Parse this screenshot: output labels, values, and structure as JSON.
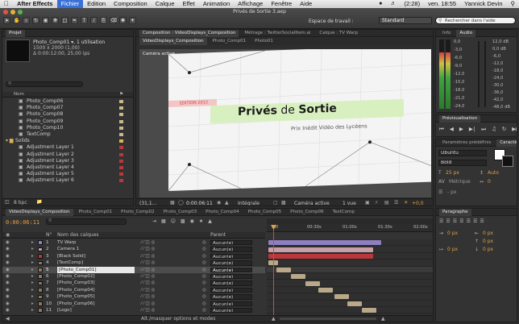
{
  "menubar": {
    "apple": "",
    "app": "After Effects",
    "items": [
      "Fichier",
      "Edition",
      "Composition",
      "Calque",
      "Effet",
      "Animation",
      "Affichage",
      "Fenêtre",
      "Aide"
    ],
    "battery": "(2:28)",
    "clock": "ven. 18:55",
    "user": "Yannick Devin"
  },
  "window": {
    "title": "Privés de Sortie 3.aep",
    "workspace_label": "Espace de travail :",
    "workspace_value": "Standard",
    "help_placeholder": "Rechercher dans l'aide"
  },
  "project": {
    "tab": "Projet",
    "item_name": "Photo_Comp01 ▾, 1 utilisation",
    "item_size": "1500 x 2000 (1,00)",
    "item_duration": "Δ 0:00:12:00, 25,00 ips",
    "search_placeholder": "",
    "column_name": "Nom",
    "items": [
      {
        "name": "Photo_Comp06",
        "indent": true
      },
      {
        "name": "Photo_Comp07",
        "indent": true
      },
      {
        "name": "Photo_Comp08",
        "indent": true
      },
      {
        "name": "Photo_Comp09",
        "indent": true
      },
      {
        "name": "Photo_Comp10",
        "indent": true
      },
      {
        "name": "TextComp",
        "indent": true
      },
      {
        "name": "Solids",
        "indent": false,
        "folder": true
      },
      {
        "name": "Adjustment Layer 1",
        "indent": true
      },
      {
        "name": "Adjustment Layer 2",
        "indent": true
      },
      {
        "name": "Adjustment Layer 3",
        "indent": true
      },
      {
        "name": "Adjustment Layer 4",
        "indent": true
      },
      {
        "name": "Adjustment Layer 5",
        "indent": true
      },
      {
        "name": "Adjustment Layer 6",
        "indent": true
      }
    ],
    "bpc": "8 bpc"
  },
  "composition": {
    "tab_prefix": "Composition :",
    "tab_name": "VideoDisplays_Composition",
    "tab_metrage": "Métrage : TwitterSocialItem.ai",
    "tab_calque": "Calque : TV Warp",
    "subtabs": [
      "VideoDisplays_Composition",
      "Photo_Comp01",
      "Photo01"
    ],
    "camera_label": "Caméra active",
    "edition_label": "EDITION 2012",
    "title_part1": "Privés",
    "title_part2": " de ",
    "title_part3": "Sortie",
    "subtitle": "Prix Inédit Vidéo des Lycéens",
    "zoom": "(31,1...",
    "timecode": "0:00:06:11",
    "resolution": "Intégrale",
    "view_camera": "Caméra active",
    "views": "1 vue",
    "offset": "+0,0"
  },
  "info_audio": {
    "tabs": [
      "Info",
      "Audio"
    ],
    "left_labels": [
      "0,0",
      "-3,0",
      "-6,0",
      "-9,0",
      "-12,0",
      "-15,0",
      "-18,0",
      "-21,0",
      "-24,0"
    ],
    "right_labels": [
      "12,0 dB",
      "0,0 dB",
      "-6,0",
      "-12,0",
      "-18,0",
      "-24,0",
      "-30,0",
      "-36,0",
      "-42,0",
      "-48,0 dB"
    ]
  },
  "preview": {
    "tab": "Prévisualisation"
  },
  "character": {
    "tabs": [
      "Paramètres prédéfinis",
      "Caractère"
    ],
    "font": "Ubuntu",
    "style": "Bold",
    "size": "25 px",
    "leading": "Auto",
    "tracking": "Métrique",
    "kerning": "0",
    "stroke": "- px"
  },
  "paragraph": {
    "tab": "Paragraphe",
    "fields": [
      "0 px",
      "0 px",
      "0 px",
      "0 px",
      "0 px"
    ]
  },
  "timeline": {
    "tabs": [
      "VideoDisplays_Composition",
      "Photo_Comp01",
      "Photo_Comp02",
      "Photo_Comp03",
      "Photo_Comp04",
      "Photo_Comp05",
      "Photo_Comp06",
      "TextComp"
    ],
    "timecode": "0:00:06:11",
    "col_num": "N°",
    "col_name": "Nom des calques",
    "col_parent": "Parent",
    "ruler": [
      "00f",
      "00:30s",
      "01:00s",
      "01:30s",
      "02:00s"
    ],
    "footer": "Alt./masquer options et modes",
    "layers": [
      {
        "num": "1",
        "name": "TV Warp",
        "color": "#8e7fc0",
        "parent": "Aucun(e)",
        "selected": false
      },
      {
        "num": "2",
        "name": "Camera 1",
        "color": "#c7a0a7",
        "parent": "Aucun(e)",
        "selected": false
      },
      {
        "num": "3",
        "name": "[Black Solid]",
        "color": "#b8383c",
        "parent": "Aucun(e)",
        "selected": false
      },
      {
        "num": "4",
        "name": "[TextComp]",
        "color": "#8a7a5a",
        "parent": "Aucun(e)",
        "selected": false
      },
      {
        "num": "5",
        "name": "[Photo_Comp01]",
        "color": "#8a7a5a",
        "parent": "Aucun(e)",
        "selected": true
      },
      {
        "num": "6",
        "name": "[Photo_Comp02]",
        "color": "#8a7a5a",
        "parent": "Aucun(e)",
        "selected": false
      },
      {
        "num": "7",
        "name": "[Photo_Comp03]",
        "color": "#8a7a5a",
        "parent": "Aucun(e)",
        "selected": false
      },
      {
        "num": "8",
        "name": "[Photo_Comp04]",
        "color": "#8a7a5a",
        "parent": "Aucun(e)",
        "selected": false
      },
      {
        "num": "9",
        "name": "[Photo_Comp05]",
        "color": "#8a7a5a",
        "parent": "Aucun(e)",
        "selected": false
      },
      {
        "num": "10",
        "name": "[Photo_Comp06]",
        "color": "#8a7a5a",
        "parent": "Aucun(e)",
        "selected": false
      },
      {
        "num": "11",
        "name": "[Logo]",
        "color": "#8a7a5a",
        "parent": "Aucun(e)",
        "selected": false
      }
    ]
  },
  "colors": {
    "accent": "#e0a040",
    "highlight_green": "#d8f0c0",
    "edition_pink": "#f3c5c5",
    "bar_purple": "#8e7fc0",
    "bar_pink": "#c7a0a7",
    "bar_red": "#b8383c",
    "bar_tan": "#b9a98a"
  }
}
